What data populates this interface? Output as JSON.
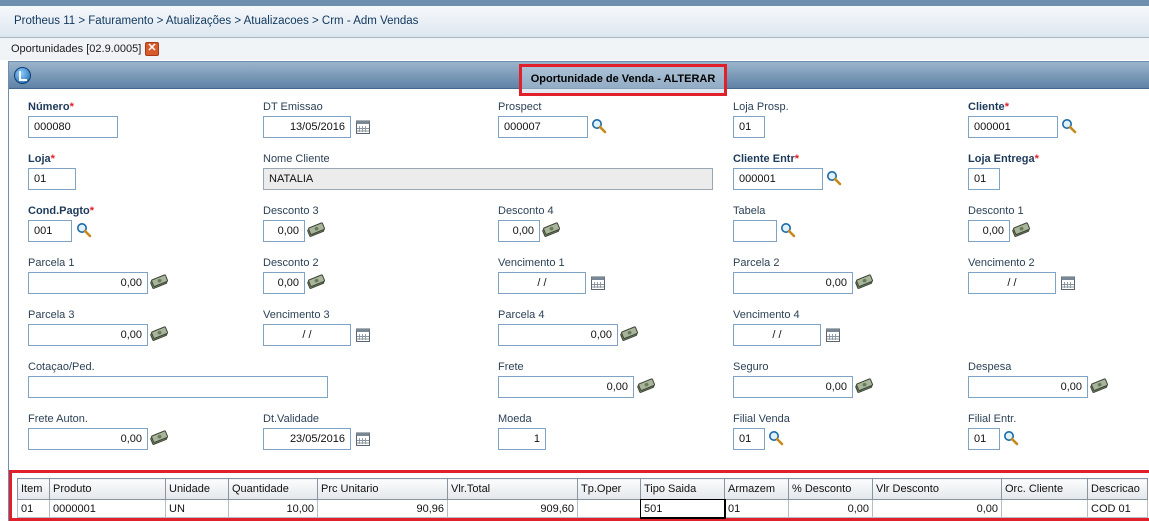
{
  "breadcrumb": "Protheus 11 > Faturamento > Atualizações > Atualizacoes > Crm - Adm Vendas",
  "tab": {
    "label": "Oportunidades [02.9.0005]",
    "close": "✕"
  },
  "window_title": "Oportunidade de Venda - ALTERAR",
  "fields": {
    "numero": {
      "label": "Número",
      "value": "000080"
    },
    "dt_emissao": {
      "label": "DT Emissao",
      "value": "13/05/2016"
    },
    "prospect": {
      "label": "Prospect",
      "value": "000007"
    },
    "loja_prosp": {
      "label": "Loja Prosp.",
      "value": "01"
    },
    "cliente": {
      "label": "Cliente",
      "value": "000001"
    },
    "loja": {
      "label": "Loja",
      "value": "01"
    },
    "nome_cliente": {
      "label": "Nome Cliente",
      "value": "NATALIA"
    },
    "cliente_entr": {
      "label": "Cliente Entr",
      "value": "000001"
    },
    "loja_entrega": {
      "label": "Loja Entrega",
      "value": "01"
    },
    "cond_pagto": {
      "label": "Cond.Pagto",
      "value": "001"
    },
    "desconto3": {
      "label": "Desconto 3",
      "value": "0,00"
    },
    "desconto4": {
      "label": "Desconto 4",
      "value": "0,00"
    },
    "tabela": {
      "label": "Tabela",
      "value": ""
    },
    "desconto1": {
      "label": "Desconto 1",
      "value": "0,00"
    },
    "parcela1": {
      "label": "Parcela 1",
      "value": "0,00"
    },
    "desconto2": {
      "label": "Desconto 2",
      "value": "0,00"
    },
    "vencimento1": {
      "label": "Vencimento 1",
      "value": "/  /"
    },
    "parcela2": {
      "label": "Parcela 2",
      "value": "0,00"
    },
    "vencimento2": {
      "label": "Vencimento 2",
      "value": "/  /"
    },
    "parcela3": {
      "label": "Parcela 3",
      "value": "0,00"
    },
    "vencimento3": {
      "label": "Vencimento 3",
      "value": "/  /"
    },
    "parcela4": {
      "label": "Parcela 4",
      "value": "0,00"
    },
    "vencimento4": {
      "label": "Vencimento 4",
      "value": "/  /"
    },
    "cotacao": {
      "label": "Cotaçao/Ped.",
      "value": ""
    },
    "frete": {
      "label": "Frete",
      "value": "0,00"
    },
    "seguro": {
      "label": "Seguro",
      "value": "0,00"
    },
    "despesa": {
      "label": "Despesa",
      "value": "0,00"
    },
    "frete_auton": {
      "label": "Frete Auton.",
      "value": "0,00"
    },
    "dt_validade": {
      "label": "Dt.Validade",
      "value": "23/05/2016"
    },
    "moeda": {
      "label": "Moeda",
      "value": "1"
    },
    "filial_venda": {
      "label": "Filial Venda",
      "value": "01"
    },
    "filial_entr": {
      "label": "Filial Entr.",
      "value": "01"
    }
  },
  "grid": {
    "headers": [
      "Item",
      "Produto",
      "Unidade",
      "Quantidade",
      "Prc Unitario",
      "Vlr.Total",
      "Tp.Oper",
      "Tipo Saida",
      "Armazem",
      "% Desconto",
      "Vlr Desconto",
      "Orc. Cliente",
      "Descricao"
    ],
    "rows": [
      [
        "01",
        "0000001",
        "UN",
        "10,00",
        "90,96",
        "909,60",
        "",
        "501",
        "01",
        "0,00",
        "0,00",
        "",
        "COD 01"
      ]
    ]
  },
  "colors": {
    "required": "#e0202a",
    "highlight": "#e0202a",
    "title_bar": "#5e82a6"
  }
}
